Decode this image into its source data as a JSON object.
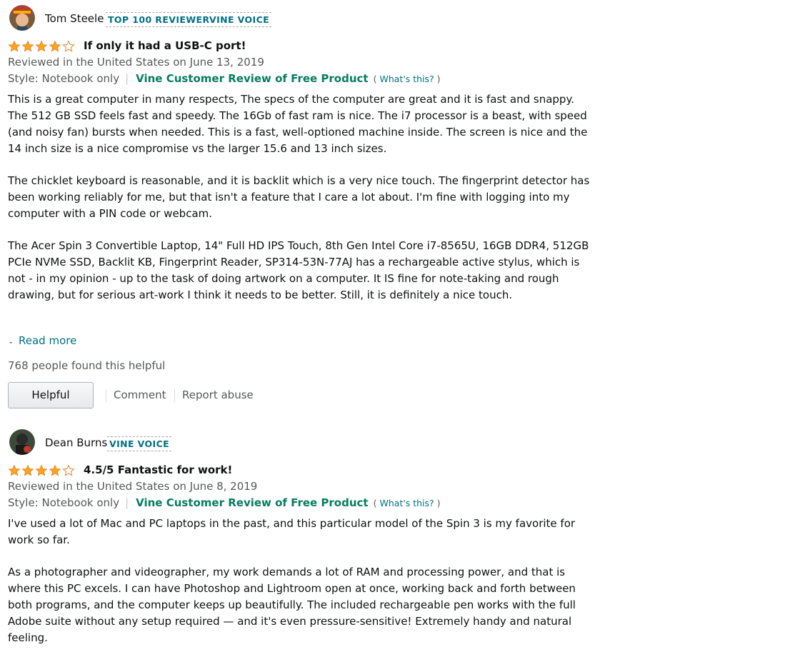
{
  "reviews": [
    {
      "reviewer": "Tom Steele",
      "badges": [
        "TOP 100 REVIEWER",
        "VINE VOICE"
      ],
      "rating": 4,
      "title": "If only it had a USB-C port!",
      "reviewed_line": "Reviewed in the United States on June 13, 2019",
      "style": "Style: Notebook only",
      "vine_label": "Vine Customer Review of Free Product",
      "whats_open": "(",
      "whats_link": "What's this?",
      "whats_close": ")",
      "paragraphs": [
        "This is a great computer in many respects, The specs of the computer are great and it is fast and snappy. The 512 GB SSD feels fast and speedy. The 16Gb of fast ram is nice. The i7 processor is a beast, with speed (and noisy fan) bursts when needed. This is a fast, well-optioned machine inside. The screen is nice and the 14 inch size is a nice compromise vs the larger 15.6 and 13 inch sizes.",
        "The chicklet keyboard is reasonable, and it is backlit which is a very nice touch. The fingerprint detector has been working reliably for me, but that isn't a feature that I care a lot about. I'm fine with logging into my computer with a PIN code or webcam.",
        "The Acer Spin 3 Convertible Laptop, 14\" Full HD IPS Touch, 8th Gen Intel Core i7-8565U, 16GB DDR4, 512GB PCIe NVMe SSD, Backlit KB, Fingerprint Reader, SP314-53N-77AJ has a rechargeable active stylus, which is not - in my opinion - up to the task of doing artwork on a computer. It IS fine for note-taking and rough drawing, but for serious art-work I think it needs to be better. Still, it is definitely a nice touch."
      ],
      "read_more": "Read more",
      "helpful_count": "768 people found this helpful",
      "helpful_button": "Helpful",
      "comment": "Comment",
      "report": "Report abuse"
    },
    {
      "reviewer": "Dean Burns",
      "badges": [
        "VINE VOICE"
      ],
      "rating": 4,
      "title": "4.5/5 Fantastic for work!",
      "reviewed_line": "Reviewed in the United States on June 8, 2019",
      "style": "Style: Notebook only",
      "vine_label": "Vine Customer Review of Free Product",
      "whats_open": "(",
      "whats_link": "What's this?",
      "whats_close": ")",
      "paragraphs": [
        "I've used a lot of Mac and PC laptops in the past, and this particular model of the Spin 3 is my favorite for work so far.",
        "As a photographer and videographer, my work demands a lot of RAM and processing power, and that is where this PC excels. I can have Photoshop and Lightroom open at once, working back and forth between both programs, and the computer keeps up beautifully. The included rechargeable pen works with the full Adobe suite without any setup required — and it's even pressure-sensitive! Extremely handy and natural feeling."
      ]
    }
  ],
  "colors": {
    "link": "#007185",
    "vine": "#067d62",
    "star": "#ffa41c",
    "muted": "#565959"
  },
  "icons": {
    "star_full": "star-filled-icon",
    "star_empty": "star-empty-icon",
    "chevron": "chevron-down-icon"
  }
}
